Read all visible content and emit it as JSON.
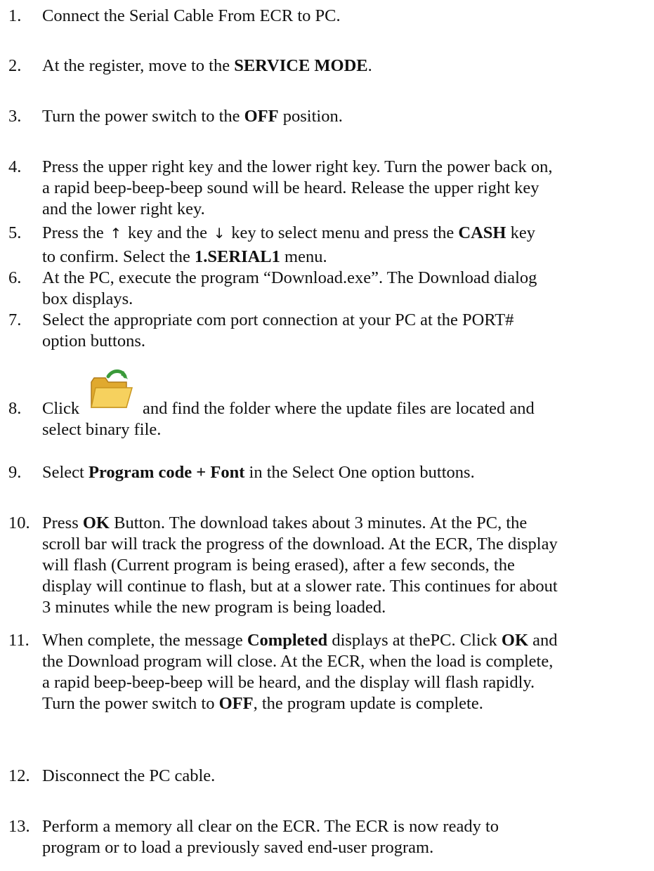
{
  "steps": [
    {
      "num": "1.",
      "parts": [
        "Connect the Serial Cable From ECR to PC."
      ]
    },
    {
      "num": "2.",
      "parts": [
        "At the register, move to the ",
        "SERVICE MODE",
        "."
      ]
    },
    {
      "num": "3.",
      "parts": [
        "Turn the power switch to the ",
        "OFF",
        " position."
      ]
    },
    {
      "num": "4.",
      "lines": [
        "Press the upper right key and the lower right key. Turn the power back on,",
        "a rapid beep-beep-beep sound will be heard. Release the upper right key",
        "and the lower right key."
      ]
    },
    {
      "num": "5.",
      "line1": [
        "Press the ",
        "↑",
        " key and the ",
        "↓",
        " key to select menu and press the ",
        "CASH",
        " key"
      ],
      "line2": [
        "to confirm. Select the ",
        "1.SERIAL1",
        " menu."
      ]
    },
    {
      "num": "6.",
      "lines": [
        "At the PC, execute the program “Download.exe”. The Download dialog",
        "box displays."
      ]
    },
    {
      "num": "7.",
      "lines": [
        "Select the appropriate com port connection at your PC at the PORT#",
        "option buttons."
      ]
    },
    {
      "num": "8.",
      "before_icon": "Click",
      "after_icon": "and find the folder where the update files are located and",
      "line2": "select binary file.",
      "icon": "open-folder-icon"
    },
    {
      "num": "9.",
      "parts": [
        "Select ",
        "Program code + Font",
        " in the Select One option buttons."
      ]
    },
    {
      "num": "10.",
      "line1": [
        "Press ",
        "OK",
        " Button. The download takes about 3 minutes. At the PC, the"
      ],
      "lines": [
        "scroll bar will track the progress of the download. At the ECR, The display",
        "will flash (Current program is being erased), after a few seconds, the",
        "display will continue to flash, but at a slower rate. This continues for about",
        "3 minutes while the new program is being loaded."
      ]
    },
    {
      "num": "11.",
      "line1": [
        "When complete, the message ",
        "Completed",
        " displays at thePC. Click ",
        "OK",
        " and"
      ],
      "lines": [
        "the Download program will close. At the ECR, when the load is complete,",
        "a rapid beep-beep-beep will be heard, and the display will flash rapidly."
      ],
      "line_last": [
        "Turn the power switch to ",
        "OFF",
        ", the program update is complete."
      ]
    },
    {
      "num": "12.",
      "parts": [
        "Disconnect the PC cable."
      ]
    },
    {
      "num": "13.",
      "lines": [
        "Perform a memory all clear on the ECR. The ECR is now ready to",
        "program or to load a previously saved end-user program."
      ]
    }
  ],
  "colors": {
    "text": "#111111",
    "folder_fill": "#f2c64a",
    "folder_arrow": "#3a9a3a"
  }
}
